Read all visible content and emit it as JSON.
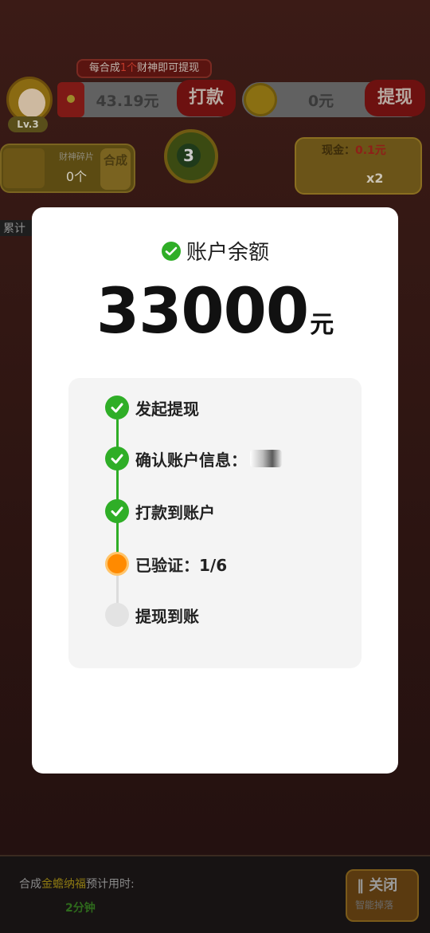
{
  "game": {
    "player": {
      "level": "Lv.3"
    },
    "tip_banner": {
      "prefix": "每合成",
      "highlight": "1个",
      "suffix": "财神即可提现"
    },
    "cash_balance": "43.19元",
    "pay_button": "打款",
    "coin_balance": "0元",
    "withdraw_button": "提现",
    "fragment": {
      "title": "财神碎片",
      "count": "0个",
      "merge_button": "合成"
    },
    "god_ball_level": "3",
    "cash_reward": {
      "label": "现金：",
      "amount": "0.1元",
      "multiplier": "x2"
    },
    "accumulate_label": "累计",
    "bottom": {
      "merge_prefix": "合成",
      "merge_target": "金蟾纳福",
      "merge_suffix": "预计用时:",
      "time": "2分钟",
      "close_label": "关闭",
      "smart_drop": "智能掉落"
    }
  },
  "modal": {
    "title": "账户余额",
    "balance_value": "33000",
    "balance_unit": "元",
    "steps": [
      {
        "label": "发起提现",
        "status": "done"
      },
      {
        "label": "确认账户信息：",
        "status": "done"
      },
      {
        "label": "打款到账户",
        "status": "done"
      },
      {
        "label": "已验证：1/6",
        "status": "current"
      },
      {
        "label": "提现到账",
        "status": "pending"
      }
    ]
  },
  "colors": {
    "success_green": "#2fae27",
    "current_orange": "#ff8a00",
    "pending_gray": "#e3e3e3"
  }
}
